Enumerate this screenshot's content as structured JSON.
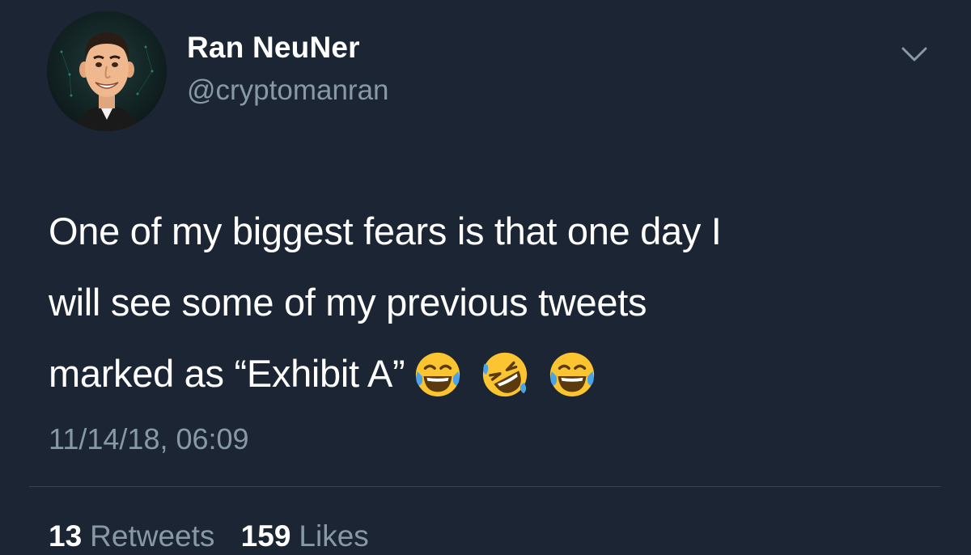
{
  "author": {
    "display_name": "Ran NeuNer",
    "handle": "@cryptomanran"
  },
  "tweet": {
    "lines": [
      "One of my biggest fears is that one day I",
      "will see some of my previous tweets",
      "marked as “Exhibit A”"
    ],
    "emojis": [
      "face-with-tears-of-joy-icon",
      "rolling-on-the-floor-laughing-icon",
      "face-with-tears-of-joy-icon"
    ],
    "timestamp": "11/14/18, 06:09"
  },
  "stats": {
    "retweets_count": "13",
    "retweets_label": "Retweets",
    "likes_count": "159",
    "likes_label": "Likes"
  },
  "colors": {
    "background": "#1c2533",
    "primary_text": "#ffffff",
    "secondary_text": "#8899a6",
    "divider": "#38444d"
  }
}
